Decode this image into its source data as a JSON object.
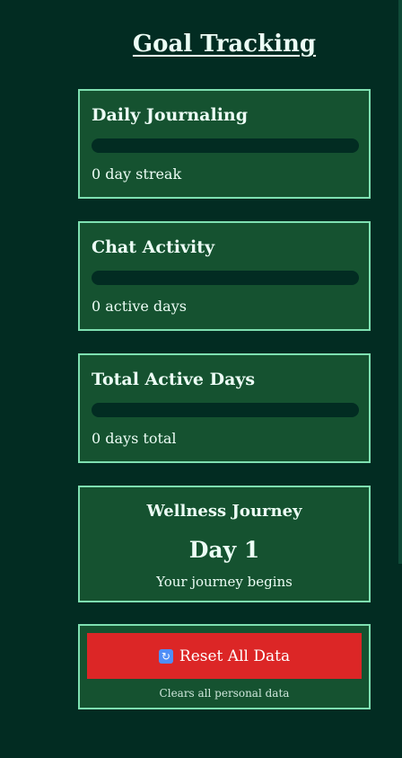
{
  "page": {
    "title": "Goal Tracking"
  },
  "goals": [
    {
      "title": "Daily Journaling",
      "progress_percent": 0,
      "caption": "0 day streak"
    },
    {
      "title": "Chat Activity",
      "progress_percent": 0,
      "caption": "0 active days"
    },
    {
      "title": "Total Active Days",
      "progress_percent": 0,
      "caption": "0 days total"
    }
  ],
  "journey": {
    "title": "Wellness Journey",
    "day": "Day 1",
    "subtitle": "Your journey begins"
  },
  "reset": {
    "icon": "refresh-icon",
    "label": "Reset All Data",
    "note": "Clears all personal data"
  },
  "colors": {
    "background": "#022c22",
    "card": "#155230",
    "card_border": "#7ee0b1",
    "track": "#022c22",
    "danger": "#dc2626",
    "text": "#ecfdf5"
  }
}
